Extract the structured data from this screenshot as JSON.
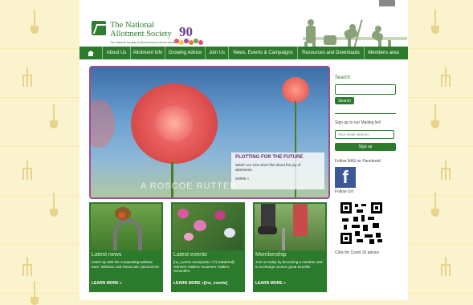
{
  "header": {
    "logo_line1": "The National",
    "logo_line2": "Allotment Society",
    "logo_sub": "The National Society of Allotment and Leisure Gardeners",
    "anniversary": "90"
  },
  "nav": {
    "home_icon": "home-icon",
    "items": [
      {
        "label": "About Us"
      },
      {
        "label": "Allotment Info"
      },
      {
        "label": "Growing Advice"
      },
      {
        "label": "Join Us"
      },
      {
        "label": "News, Events & Campaigns"
      },
      {
        "label": "Resources and Downloads"
      },
      {
        "label": "Members area"
      }
    ]
  },
  "hero": {
    "title": "PLOTTING FOR THE FUTURE",
    "description": "Watch our new short film about the joy of allotments.",
    "more": "MORE »",
    "credit": "A ROSCOE RUTTER"
  },
  "sidebar": {
    "search_label": "Search",
    "search_value": "",
    "search_button": "Search",
    "mailing_label": "Sign up to our Mailing list!",
    "email_placeholder": "Your email address",
    "signup_button": "Sign up",
    "facebook_label": "Follow NAS on Facebook!",
    "facebook_icon": "facebook-icon",
    "follow_label": "Follow Us!",
    "qr_caption": "Click for Covid 19 advice"
  },
  "cards": [
    {
      "title": "Latest news",
      "text": "Catch up with the composting webinar here: Webinar Link Passcode: p9x1C0U%",
      "more": "LEARN MORE »"
    },
    {
      "title": "Latest events",
      "text": "[no_events noneposts=\"1\"] %date%@ %time% %title% %name% %title% %month%",
      "more": "LEARN MORE »[/no_events]"
    },
    {
      "title": "Membership",
      "text": "Join us today by becoming a member and in exchange receive great benefits",
      "more": "LEARN MORE »"
    }
  ],
  "colors": {
    "brand_green": "#2c7a2c",
    "hero_border": "#9a4f9a",
    "background": "#fbf3cd"
  }
}
